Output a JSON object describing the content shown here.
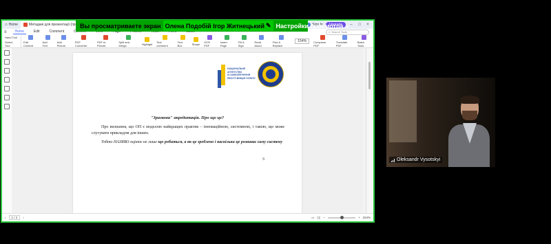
{
  "zoom_banner": {
    "message": "Вы просматриваете экран",
    "sharer_names": "Олена Подобій Ігор Житнецький",
    "view_options": "Настройки просмотра"
  },
  "app": {
    "tabs": [
      {
        "label": "Home"
      },
      {
        "label": "Метадані для презентації (проф"
      }
    ],
    "sign_in": "Sign In",
    "upgrade": "Upgrade",
    "menu": [
      "Home",
      "Edit",
      "Comment",
      "Convert",
      "View",
      "Page",
      "Protect",
      "Tools",
      "Form",
      "Batch"
    ],
    "active_menu": "Home",
    "search_placeholder": "Search Tools",
    "ribbon_left": [
      "Hand Tool",
      "Select Tool"
    ],
    "ribbon_tools": [
      "Edit Content",
      "Add Text",
      "Add Picture",
      "PDF Converter",
      "PDF to Picture",
      "Split and Merge",
      "Highlight",
      "Text comment",
      "Text Box",
      "Shape",
      "OCR PDF",
      "Insert Page",
      "Fill & Sign",
      "Read Aloud",
      "Find & Replace",
      "Compress PDF",
      "Translate PDF",
      "Protect",
      "Password Protect",
      "Batch Tools"
    ],
    "zoom_level": "154%",
    "status_page": "1 / 2"
  },
  "document": {
    "logo_text": "НАЦІОНАЛЬНЕ\nАГЕНТСТВО\nІЗ ЗАБЕЗПЕЧЕННЯ\nЯКОСТІ ВИЩОЇ ОСВІТИ",
    "title": "\"Зразкова\" акредитація. Про що це?",
    "para1": "Про визнання, що ОП є моделлю найкращих практик – інноваційною, системною, і такою, що може слугувати прикладом для інших.",
    "para2_start": "Тобто НАЗЯВО оцінює не лише ",
    "para2_bold": "що робиться",
    "para2_end": ", а як це зроблено і наскільки це розвиває саму систему",
    "cursor_char": "S"
  },
  "participant": {
    "name": "Oleksandr Vysotskyi"
  },
  "colors": {
    "banner_green": "#00a300",
    "frame_green": "#2ecc40",
    "accent": "#4a6cf7"
  }
}
